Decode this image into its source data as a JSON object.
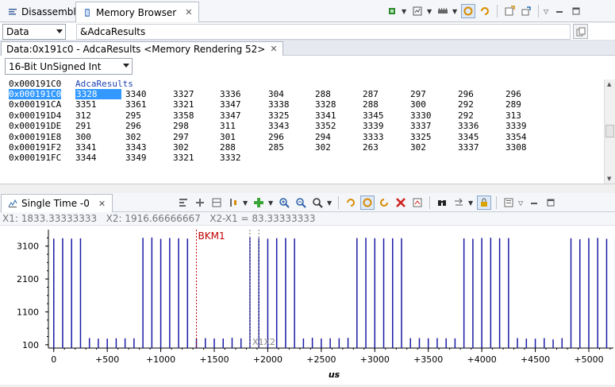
{
  "top_tabs": {
    "disassembly": "Disassembly",
    "memory_browser": "Memory Browser"
  },
  "memory_toolbar": {
    "space_value": "Data",
    "expression_value": "&AdcaResults"
  },
  "rendering": {
    "tab_label": "Data:0x191c0 - AdcaResults <Memory Rendering 52>",
    "format_value": "16-Bit UnSigned Int",
    "label_row": {
      "address": "0x000191C0",
      "symbol": "AdcaResults"
    },
    "rows": [
      {
        "address": "0x000191C0",
        "values": [
          "3328",
          "3340",
          "3327",
          "3336",
          "304",
          "288",
          "287",
          "297",
          "296",
          "296"
        ]
      },
      {
        "address": "0x000191CA",
        "values": [
          "3351",
          "3361",
          "3321",
          "3347",
          "3338",
          "3328",
          "288",
          "300",
          "292",
          "289"
        ]
      },
      {
        "address": "0x000191D4",
        "values": [
          "312",
          "295",
          "3358",
          "3347",
          "3325",
          "3341",
          "3345",
          "3330",
          "292",
          "313"
        ]
      },
      {
        "address": "0x000191DE",
        "values": [
          "291",
          "296",
          "298",
          "311",
          "3343",
          "3352",
          "3339",
          "3337",
          "3336",
          "3339"
        ]
      },
      {
        "address": "0x000191E8",
        "values": [
          "300",
          "302",
          "297",
          "301",
          "296",
          "294",
          "3333",
          "3325",
          "3345",
          "3354"
        ]
      },
      {
        "address": "0x000191F2",
        "values": [
          "3341",
          "3343",
          "302",
          "288",
          "285",
          "302",
          "263",
          "302",
          "3337",
          "3308"
        ]
      },
      {
        "address": "0x000191FC",
        "values": [
          "3344",
          "3349",
          "3321",
          "3332"
        ]
      }
    ]
  },
  "graph": {
    "tab_label": "Single Time -0",
    "status": {
      "x1": "X1: 1833.33333333",
      "x2": "X2: 1916.66666667",
      "delta": "X2-X1 = 83.33333333"
    }
  },
  "chart_data": {
    "type": "bar",
    "title": "",
    "xlabel": "us",
    "ylabel": "",
    "xlim": [
      -50,
      5230
    ],
    "ylim": [
      0,
      3600
    ],
    "x_ticks": [
      "0",
      "+500",
      "+1000",
      "+1500",
      "+2000",
      "+2500",
      "+3000",
      "+3500",
      "+4000",
      "+4500",
      "+5000"
    ],
    "y_ticks": [
      "100",
      "1100",
      "2100",
      "3100"
    ],
    "bar_color": "#1a1aa6",
    "x_step_us": 83.33333333,
    "values": [
      3328,
      3340,
      3327,
      3336,
      304,
      288,
      287,
      297,
      296,
      296,
      3351,
      3361,
      3321,
      3347,
      3338,
      3328,
      288,
      300,
      292,
      289,
      312,
      295,
      3358,
      3347,
      3325,
      3341,
      3345,
      3330,
      292,
      313,
      291,
      296,
      298,
      311,
      3343,
      3352,
      3339,
      3337,
      3336,
      3339,
      300,
      302,
      297,
      301,
      296,
      294,
      3333,
      3325,
      3345,
      3354,
      3341,
      3343,
      302,
      288,
      285,
      302,
      263,
      302,
      3337,
      3308,
      3344,
      3349,
      3321,
      3332
    ],
    "markers": [
      {
        "label": "BKM1",
        "x": 1333.33,
        "color": "#c00000"
      },
      {
        "label": "X1",
        "x": 1833.33,
        "color": "#808080"
      },
      {
        "label": "X2",
        "x": 1916.67,
        "color": "#808080"
      }
    ],
    "marker_text_x1x2": "X1X2"
  }
}
